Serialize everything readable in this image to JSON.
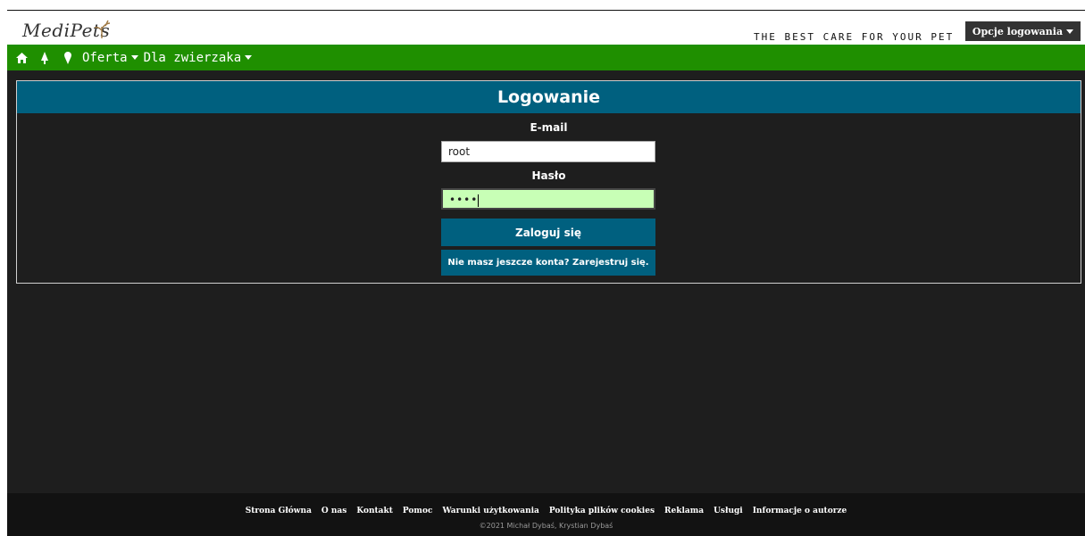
{
  "header": {
    "logo_text": "MediPets",
    "tagline": "THE BEST CARE FOR YOUR PET",
    "login_options_label": "Opcje logowania"
  },
  "nav": {
    "items": [
      {
        "label": "Oferta"
      },
      {
        "label": "Dla zwierzaka"
      }
    ]
  },
  "login": {
    "title": "Logowanie",
    "email_label": "E-mail",
    "email_value": "root",
    "password_label": "Hasło",
    "password_value": "••••",
    "login_button": "Zaloguj się",
    "register_button": "Nie masz jeszcze konta? Zarejestruj się."
  },
  "footer": {
    "links": [
      "Strona Główna",
      "O nas",
      "Kontakt",
      "Pomoc",
      "Warunki użytkowania",
      "Polityka plików cookies",
      "Reklama",
      "Usługi",
      "Informacje o autorze"
    ],
    "copyright": "©2021 Michał Dybaś, Krystian Dybaś"
  },
  "colors": {
    "nav_green": "#1f8f00",
    "primary_teal": "#00607f",
    "background_dark": "#1e1e1e",
    "password_field_green": "#c8ffb6"
  },
  "icons": [
    "home-icon",
    "tree-icon",
    "ice-cream-icon",
    "chevron-down-icon"
  ]
}
